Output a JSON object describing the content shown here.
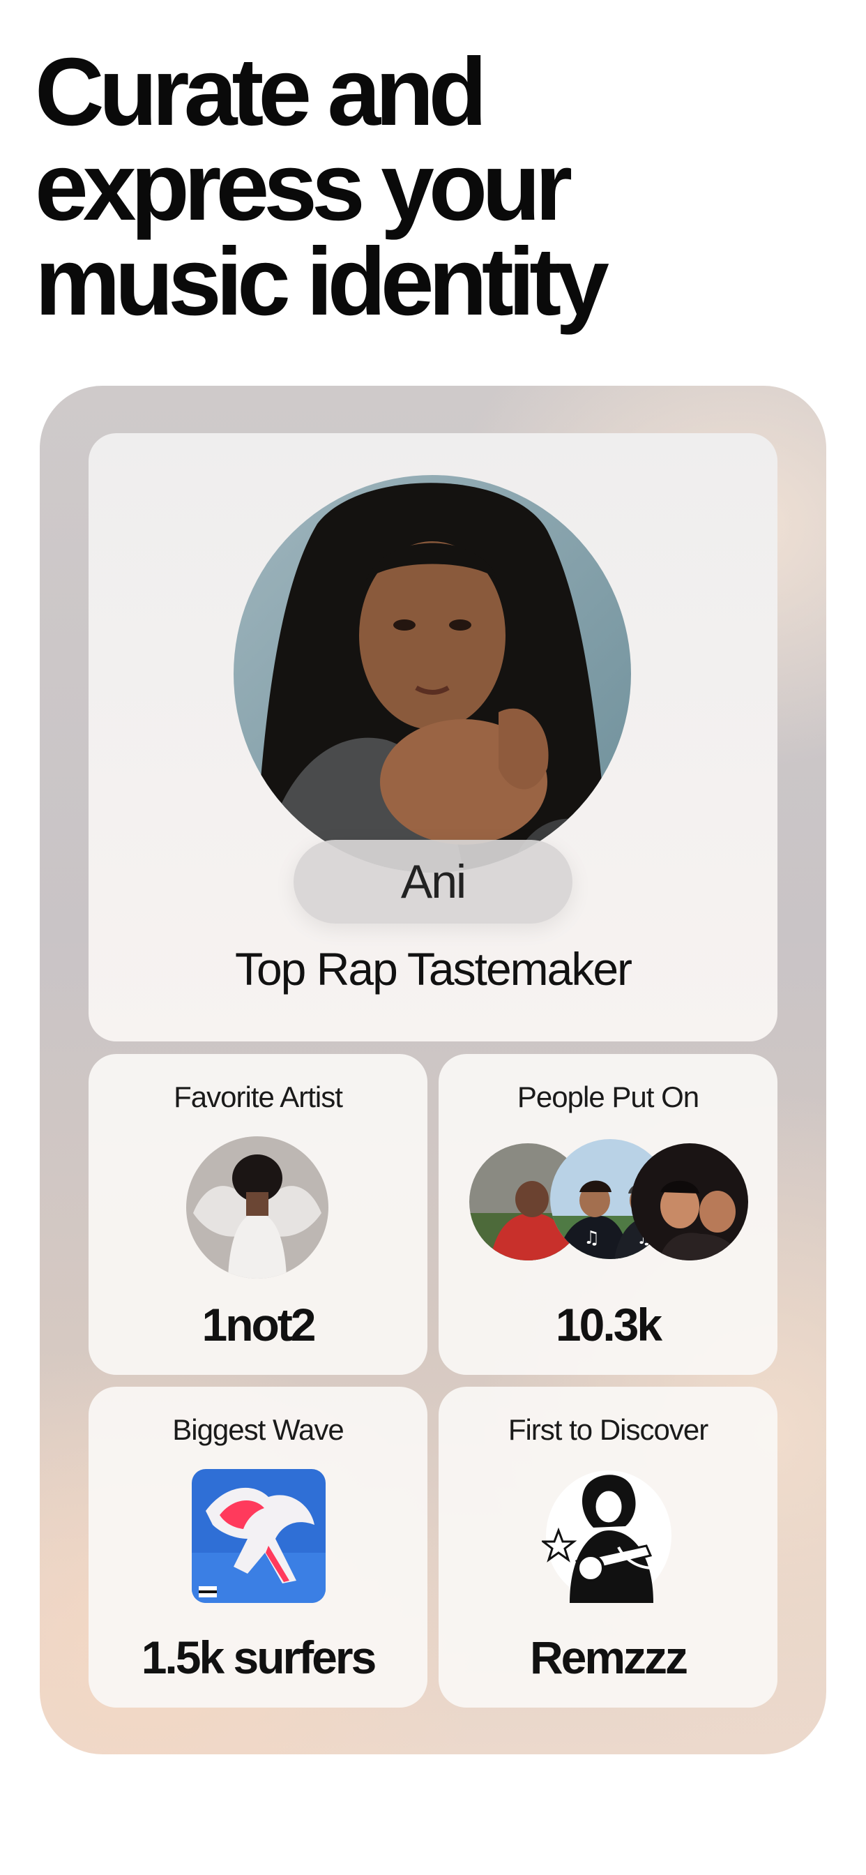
{
  "headline": {
    "line1": "Curate and",
    "line2": "express your",
    "line3": "music identity"
  },
  "profile": {
    "name": "Ani",
    "title": "Top Rap Tastemaker",
    "photo_icon": "profile-photo"
  },
  "stats": [
    {
      "label": "Favorite Artist",
      "value": "1not2",
      "thumb": "artist-photo"
    },
    {
      "label": "People Put On",
      "value": "10.3k",
      "thumb": "people-avatars"
    },
    {
      "label": "Biggest Wave",
      "value": "1.5k surfers",
      "thumb": "album-cover-horse"
    },
    {
      "label": "First to Discover",
      "value": "Remzzz",
      "thumb": "artist-sketch"
    }
  ],
  "colors": {
    "background": "#ffffff",
    "text": "#111111",
    "card": "#f8f5f3",
    "album_blue": "#2f6fd6",
    "album_red": "#ff3a5c"
  }
}
